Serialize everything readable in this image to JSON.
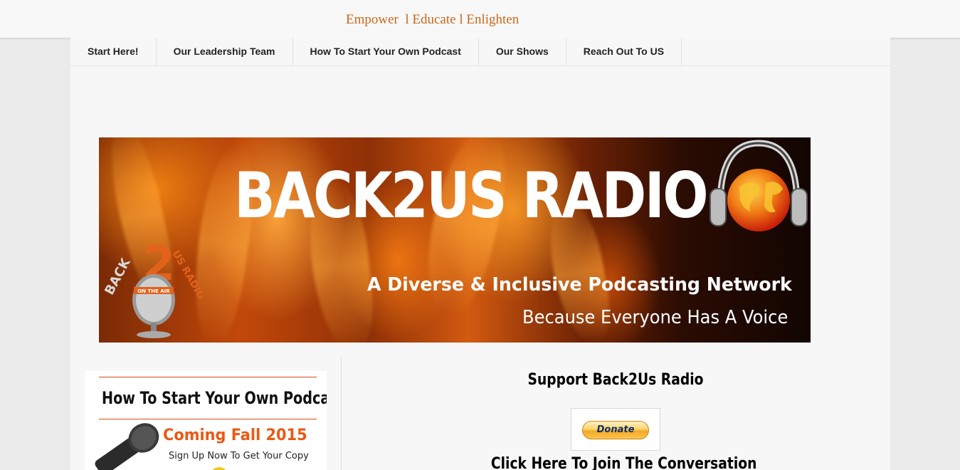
{
  "header": {
    "tagline": "Empower  l Educate l Enlighten"
  },
  "nav": {
    "items": [
      {
        "label": "Start Here!"
      },
      {
        "label": "Our Leadership Team"
      },
      {
        "label": "How To Start Your Own Podcast"
      },
      {
        "label": "Our Shows"
      },
      {
        "label": "Reach Out To US"
      }
    ]
  },
  "banner": {
    "title": "BACK2US RADIO",
    "subtitle": "A Diverse & Inclusive Podcasting Network",
    "slogan": "Because Everyone Has A Voice",
    "logo_text_number": "2",
    "logo_text_left": "BACK",
    "logo_text_right": "US RADIO",
    "logo_text_badge": "ON THE AIR",
    "colors": {
      "fire_orange": "#e8740f",
      "logo_orange": "#e2621c"
    }
  },
  "podcast_widget": {
    "title": "How To Start Your Own Podcast",
    "coming": "Coming Fall 2015",
    "signup": "Sign Up Now To Get Your Copy",
    "accent": "#ea5a14"
  },
  "support": {
    "title": "Support Back2Us Radio",
    "donate_label": "Donate",
    "join_label": "Click Here To Join The Conversation"
  }
}
